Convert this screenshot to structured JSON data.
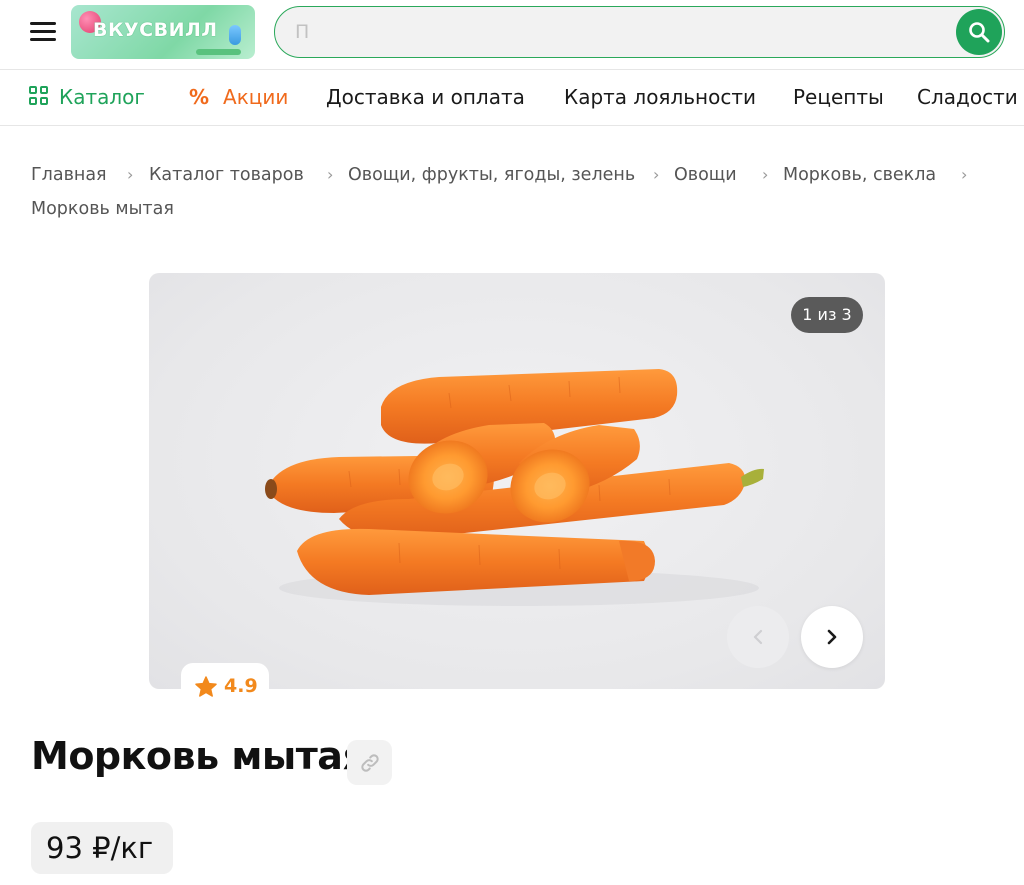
{
  "header": {
    "logo_text": "ВКУСВИЛЛ",
    "search_value": "",
    "search_placeholder": "П"
  },
  "nav": {
    "catalog": "Каталог",
    "promo_icon": "%",
    "promo": "Акции",
    "delivery": "Доставка и оплата",
    "loyalty": "Карта лояльности",
    "recipes": "Рецепты",
    "sweets": "Сладости"
  },
  "breadcrumbs": [
    "Главная",
    "Каталог товаров",
    "Овощи, фрукты, ягоды, зелень",
    "Овощи",
    "Морковь, свекла",
    "Морковь мытая"
  ],
  "gallery": {
    "counter": "1 из 3",
    "rating": "4.9"
  },
  "product": {
    "title": "Морковь мытая",
    "price": "93 ₽/кг"
  },
  "colors": {
    "brand_green": "#1fa35a",
    "promo_orange": "#f06a1c",
    "rating_orange": "#f2891c",
    "carrot": "#f47a23"
  },
  "icons": [
    "menu-icon",
    "search-icon",
    "catalog-grid-icon",
    "chevron-left-icon",
    "chevron-right-icon",
    "star-icon",
    "link-icon"
  ]
}
